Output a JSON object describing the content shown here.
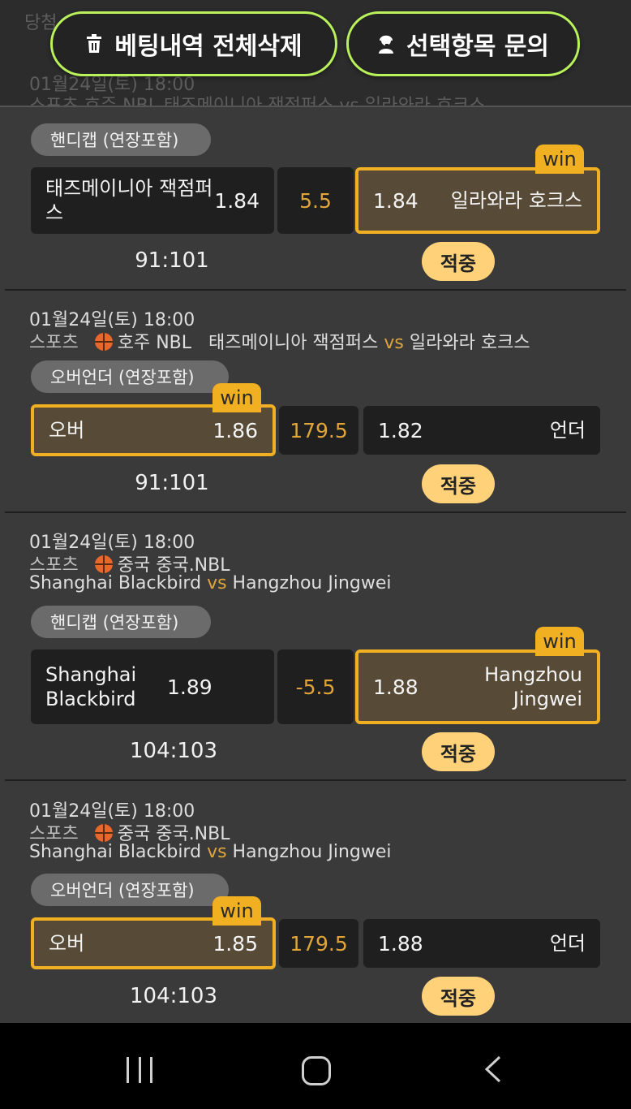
{
  "header": {
    "ghost_line1": "당첨",
    "ghost_line2": "01월24일(토) 18:00",
    "ghost_line3": "스포츠  호주 NBL  태즈메이니아 잭점퍼스 vs 일라와라 호크스",
    "delete_all_label": "베팅내역 전체삭제",
    "inquiry_label": "선택항목 문의",
    "delete_icon": "trash-icon",
    "inquiry_icon": "support-agent-icon"
  },
  "bets": [
    {
      "date": "",
      "sport": "",
      "league": "",
      "home": "",
      "away": "",
      "market": "핸디캡 (연장포함)",
      "left": {
        "name": "태즈메이니아 잭점퍼스",
        "odd": "1.84"
      },
      "line": "5.5",
      "right": {
        "name": "일라와라 호크스",
        "odd": "1.84"
      },
      "winner": "right",
      "score": "91:101",
      "result": "적중"
    },
    {
      "date": "01월24일(토) 18:00",
      "sport": "스포츠",
      "league": "호주 NBL",
      "home": "태즈메이니아 잭점퍼스",
      "away": "일라와라 호크스",
      "market": "오버언더 (연장포함)",
      "left": {
        "name": "오버",
        "odd": "1.86"
      },
      "line": "179.5",
      "right": {
        "name": "언더",
        "odd": "1.82"
      },
      "winner": "left",
      "score": "91:101",
      "result": "적중"
    },
    {
      "date": "01월24일(토) 18:00",
      "sport": "스포츠",
      "league": "중국 중국.NBL",
      "home": "Shanghai Blackbird",
      "away": "Hangzhou Jingwei",
      "market": "핸디캡 (연장포함)",
      "left": {
        "name": "Shanghai Blackbird",
        "odd": "1.89"
      },
      "line": "-5.5",
      "right": {
        "name": "Hangzhou Jingwei",
        "odd": "1.88"
      },
      "winner": "right",
      "score": "104:103",
      "result": "적중"
    },
    {
      "date": "01월24일(토) 18:00",
      "sport": "스포츠",
      "league": "중국 중국.NBL",
      "home": "Shanghai Blackbird",
      "away": "Hangzhou Jingwei",
      "market": "오버언더 (연장포함)",
      "left": {
        "name": "오버",
        "odd": "1.85"
      },
      "line": "179.5",
      "right": {
        "name": "언더",
        "odd": "1.88"
      },
      "winner": "left",
      "score": "104:103",
      "result": "적중"
    }
  ],
  "labels": {
    "vs": "vs",
    "win": "win",
    "sport_icon": "basketball-icon"
  },
  "colors": {
    "accent": "#f0b021",
    "button_border": "#b9f25a",
    "hit_badge": "#ffd27a"
  },
  "navbar": {
    "recent": "recent-apps-icon",
    "home": "home-icon",
    "back": "back-icon"
  }
}
